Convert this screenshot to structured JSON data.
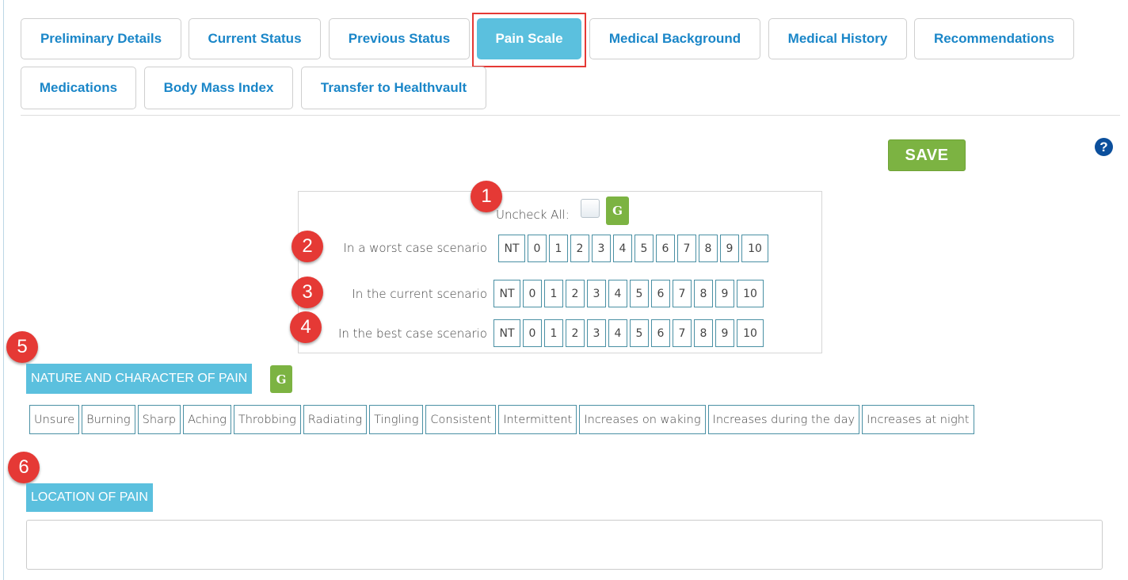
{
  "tabs": [
    {
      "label": "Preliminary Details"
    },
    {
      "label": "Current Status"
    },
    {
      "label": "Previous Status"
    },
    {
      "label": "Pain Scale"
    },
    {
      "label": "Medical Background"
    },
    {
      "label": "Medical History"
    },
    {
      "label": "Recommendations"
    },
    {
      "label": "Medications"
    },
    {
      "label": "Body Mass Index"
    },
    {
      "label": "Transfer to Healthvault"
    }
  ],
  "active_tab": "Pain Scale",
  "save_label": "SAVE",
  "help_glyph": "?",
  "pain_scale": {
    "uncheck_all_label": "Uncheck All:",
    "g_label": "G",
    "rows": [
      {
        "label": "In a worst case scenario"
      },
      {
        "label": "In the current scenario"
      },
      {
        "label": "In the best case scenario"
      }
    ],
    "values": [
      "NT",
      "0",
      "1",
      "2",
      "3",
      "4",
      "5",
      "6",
      "7",
      "8",
      "9",
      "10"
    ]
  },
  "markers": [
    "1",
    "2",
    "3",
    "4",
    "5",
    "6"
  ],
  "nature": {
    "heading": "NATURE AND CHARACTER OF PAIN",
    "g_label": "G",
    "options": [
      "Unsure",
      "Burning",
      "Sharp",
      "Aching",
      "Throbbing",
      "Radiating",
      "Tingling",
      "Consistent",
      "Intermittent",
      "Increases on waking",
      "Increases during the day",
      "Increases at night"
    ]
  },
  "location": {
    "heading": "LOCATION OF PAIN",
    "value": ""
  },
  "colors": {
    "link": "#1a86c8",
    "active_tab": "#5bc0de",
    "save": "#7cb342",
    "marker": "#e53935",
    "help": "#0b4f9c"
  }
}
